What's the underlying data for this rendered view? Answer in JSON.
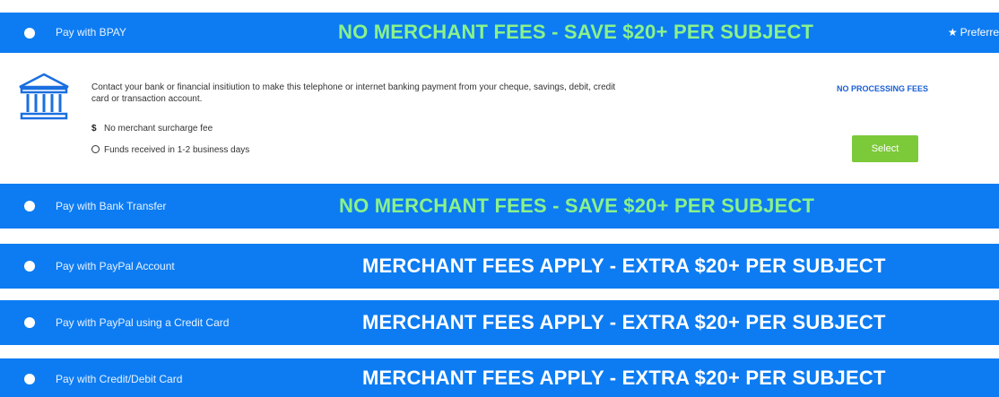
{
  "colors": {
    "bar_blue": "#0d7cf2",
    "promo_green": "#8af28a",
    "select_green": "#7cc93a",
    "link_blue": "#1a5fd6"
  },
  "options": [
    {
      "label": "Pay with BPAY",
      "promo": "NO MERCHANT FEES - SAVE $20+ PER SUBJECT",
      "badge": "Preferre",
      "badge_icon": "star-icon",
      "selected": true
    },
    {
      "label": "Pay with Bank Transfer",
      "promo": "NO MERCHANT FEES - SAVE $20+ PER SUBJECT",
      "selected": false
    },
    {
      "label": "Pay with PayPal Account",
      "promo": "MERCHANT FEES APPLY - EXTRA $20+ PER SUBJECT",
      "selected": false
    },
    {
      "label": "Pay with PayPal using a Credit Card",
      "promo": "MERCHANT FEES APPLY - EXTRA $20+ PER SUBJECT",
      "selected": false
    },
    {
      "label": "Pay with Credit/Debit Card",
      "promo": "MERCHANT FEES APPLY - EXTRA $20+ PER SUBJECT",
      "selected": false
    }
  ],
  "bpay_detail": {
    "icon": "bank-icon",
    "description": "Contact your bank or financial insitiution to make this telephone or internet banking payment from your cheque, savings, debit, credit card or transaction account.",
    "features": [
      {
        "icon": "dollar-icon",
        "glyph": "$",
        "text": "No merchant surcharge fee"
      },
      {
        "icon": "clock-icon",
        "text": "Funds received in 1-2 business days"
      }
    ],
    "fee_note": "NO PROCESSING FEES",
    "select_label": "Select"
  }
}
